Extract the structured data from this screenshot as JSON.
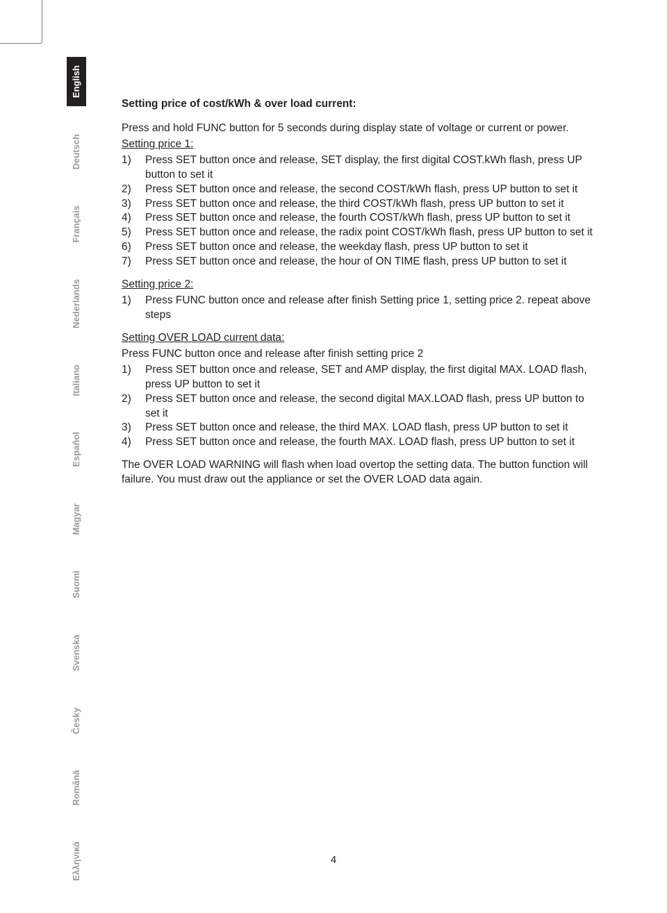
{
  "languages": [
    {
      "label": "English",
      "active": true
    },
    {
      "label": "Deutsch",
      "active": false
    },
    {
      "label": "Français",
      "active": false
    },
    {
      "label": "Nederlands",
      "active": false
    },
    {
      "label": "Italiano",
      "active": false
    },
    {
      "label": "Español",
      "active": false
    },
    {
      "label": "Magyar",
      "active": false
    },
    {
      "label": "Suomi",
      "active": false
    },
    {
      "label": "Svenska",
      "active": false
    },
    {
      "label": "Česky",
      "active": false
    },
    {
      "label": "Română",
      "active": false
    },
    {
      "label": "Ελληνικά",
      "active": false
    }
  ],
  "title": "Setting price of cost/kWh & over load current:",
  "intro1": "Press and hold FUNC button for 5 seconds during display state of voltage or current or power.",
  "sp1_heading": "Setting price 1:",
  "sp1": [
    {
      "n": "1)",
      "t": "Press SET button once and release, SET display, the first digital COST.kWh flash, press UP button to set it"
    },
    {
      "n": "2)",
      "t": "Press SET button once and release, the second COST/kWh flash, press UP button to set it"
    },
    {
      "n": "3)",
      "t": "Press SET button once and release, the third COST/kWh flash, press UP button to set it"
    },
    {
      "n": "4)",
      "t": "Press SET button once and release, the fourth COST/kWh flash, press UP button to set it"
    },
    {
      "n": "5)",
      "t": "Press SET button once and release, the radix point COST/kWh flash, press UP button to set it"
    },
    {
      "n": "6)",
      "t": "Press SET button once and release, the weekday flash, press UP button to set it"
    },
    {
      "n": "7)",
      "t": "Press SET button once and release, the hour of ON TIME flash, press UP button to set it"
    }
  ],
  "sp2_heading": "Setting price 2:",
  "sp2": [
    {
      "n": "1)",
      "t": "Press FUNC button once and release after finish Setting price 1, setting price 2. repeat above steps"
    }
  ],
  "ol_heading": "Setting OVER LOAD current data:",
  "ol_intro": "Press FUNC button once and release after finish setting price 2",
  "ol": [
    {
      "n": "1)",
      "t": "Press SET button once and release, SET and AMP display, the first digital MAX. LOAD flash, press UP button to set it"
    },
    {
      "n": "2)",
      "t": "Press SET button once and release, the second digital MAX.LOAD flash, press UP button to set it"
    },
    {
      "n": "3)",
      "t": "Press SET button once and release, the third MAX. LOAD flash, press UP button to set it"
    },
    {
      "n": "4)",
      "t": "Press SET button once and release, the fourth MAX. LOAD flash, press UP button to set it"
    }
  ],
  "warn": "The OVER LOAD WARNING will flash when load overtop the setting data. The button function will failure. You must draw out the appliance or set the OVER LOAD data again.",
  "page": "4"
}
